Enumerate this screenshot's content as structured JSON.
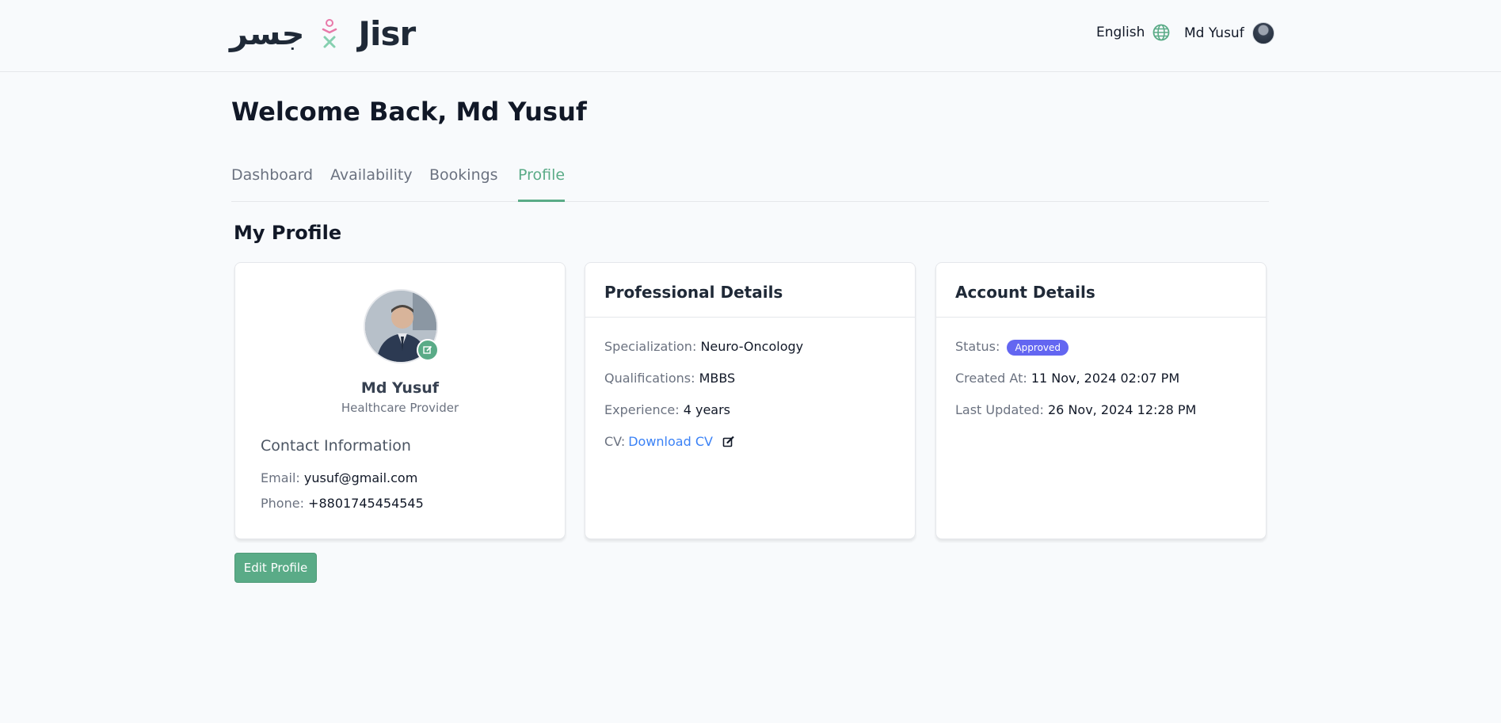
{
  "header": {
    "logo_arabic": "جسر",
    "logo_english": "Jisr",
    "language": "English",
    "user_name": "Md Yusuf"
  },
  "welcome": "Welcome Back, Md Yusuf",
  "tabs": [
    {
      "label": "Dashboard",
      "active": false
    },
    {
      "label": "Availability",
      "active": false
    },
    {
      "label": "Bookings",
      "active": false
    },
    {
      "label": "Profile",
      "active": true
    }
  ],
  "profile": {
    "section_title": "My Profile",
    "name": "Md Yusuf",
    "role": "Healthcare Provider",
    "contact_title": "Contact Information",
    "email_label": "Email:",
    "email": "yusuf@gmail.com",
    "phone_label": "Phone:",
    "phone": "+8801745454545"
  },
  "professional": {
    "title": "Professional Details",
    "specialization_label": "Specialization:",
    "specialization": "Neuro-Oncology",
    "qualifications_label": "Qualifications:",
    "qualifications": "MBBS",
    "experience_label": "Experience:",
    "experience": "4 years",
    "cv_label": "CV:",
    "cv_link": "Download CV"
  },
  "account": {
    "title": "Account Details",
    "status_label": "Status:",
    "status": "Approved",
    "created_label": "Created At:",
    "created": "11 Nov, 2024 02:07 PM",
    "updated_label": "Last Updated:",
    "updated": "26 Nov, 2024 12:28 PM"
  },
  "actions": {
    "edit_profile": "Edit Profile"
  },
  "colors": {
    "accent": "#5aab87",
    "badge": "#6366f1",
    "link": "#3b82f6"
  }
}
